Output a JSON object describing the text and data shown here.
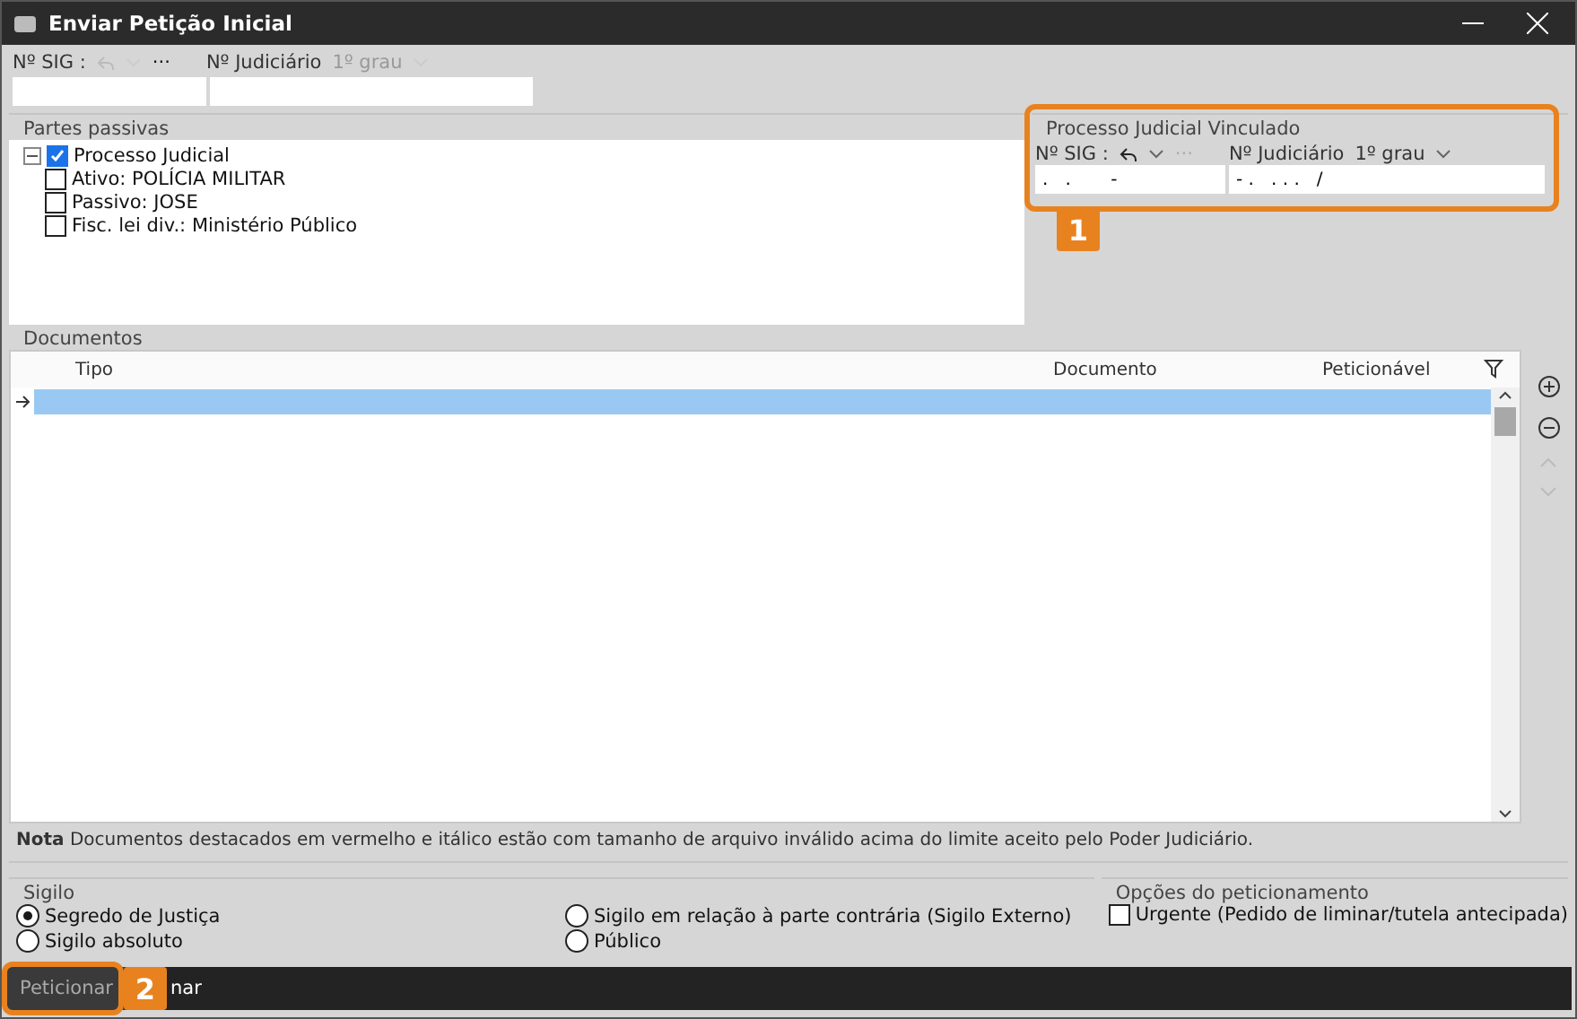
{
  "window": {
    "title": "Enviar Petição Inicial"
  },
  "top": {
    "sig_label": "Nº SIG :",
    "more": "···",
    "judiciario_label": "Nº Judiciário",
    "grau": "1º grau"
  },
  "partes": {
    "title": "Partes passivas",
    "tree": [
      {
        "label": "Processo Judicial",
        "checked": true,
        "expanded": true,
        "children": [
          {
            "label": "Ativo: POLÍCIA MILITAR",
            "checked": false
          },
          {
            "label": "Passivo: JOSE",
            "checked": false
          },
          {
            "label": "Fisc. lei div.: Ministério Público",
            "checked": false
          }
        ]
      }
    ]
  },
  "vinculado": {
    "title": "Processo Judicial Vinculado",
    "sig_label": "Nº SIG :",
    "more": "···",
    "judiciario_label": "Nº Judiciário",
    "grau": "1º grau",
    "sig_value": ".   .       -",
    "judiciario_value": "- .   . . .   /"
  },
  "documentos": {
    "title": "Documentos",
    "columns": [
      "Tipo",
      "Documento",
      "Peticionável"
    ],
    "rows": [
      {
        "selected": true
      }
    ]
  },
  "note": {
    "label": "Nota",
    "text": "Documentos destacados em vermelho e itálico estão com tamanho de arquivo inválido acima do limite aceito pelo Poder Judiciário."
  },
  "sigilo": {
    "title": "Sigilo",
    "options": [
      {
        "label": "Segredo de Justiça",
        "selected": true
      },
      {
        "label": "Sigilo absoluto",
        "selected": false
      },
      {
        "label": "Sigilo em relação à parte contrária (Sigilo Externo)",
        "selected": false
      },
      {
        "label": "Público",
        "selected": false
      }
    ]
  },
  "opcoes": {
    "title": "Opções do peticionamento",
    "items": [
      {
        "label": "Urgente (Pedido de liminar/tutela antecipada)",
        "checked": false
      }
    ]
  },
  "actions": [
    "Peticionar",
    "nar"
  ],
  "callouts": [
    "1",
    "2"
  ]
}
